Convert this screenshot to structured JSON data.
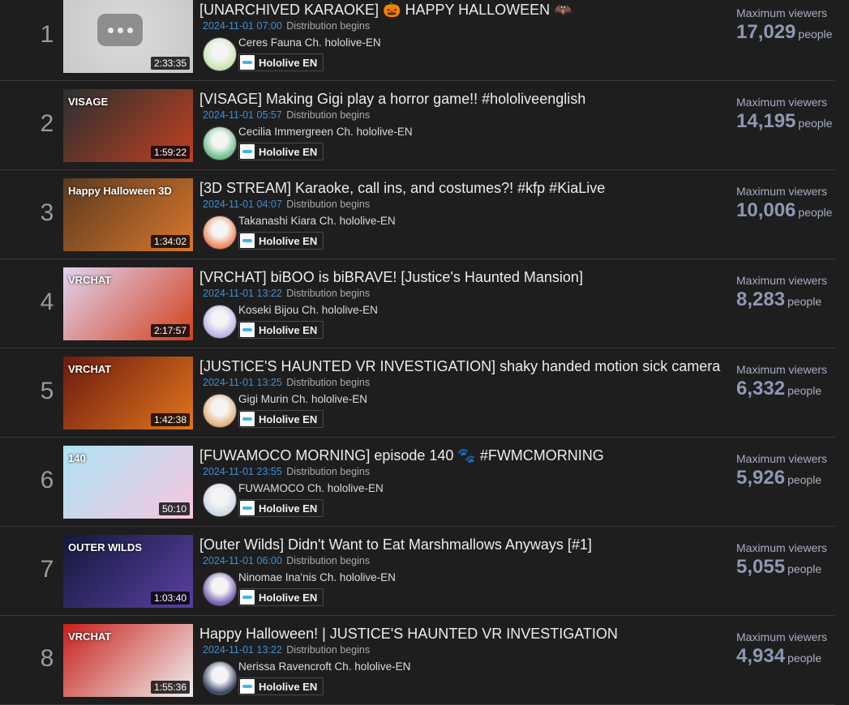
{
  "viewers_label": "Maximum viewers",
  "viewers_unit": "people",
  "distribution_label": "Distribution begins",
  "rows": [
    {
      "rank": "1",
      "title": "[UNARCHIVED KARAOKE] 🎃 HAPPY HALLOWEEN 🦇",
      "date": "2024-11-01 07:00",
      "channel": "Ceres Fauna Ch. hololive-EN",
      "org": "Hololive EN",
      "duration": "2:33:35",
      "viewers": "17,029",
      "thumb_colors": [
        "#dcdcdc",
        "#c8c8c8"
      ],
      "avatar_color": "#c9e6b0"
    },
    {
      "rank": "2",
      "title": "[VISAGE] Making Gigi play a horror game!! #hololiveenglish",
      "date": "2024-11-01 05:57",
      "channel": "Cecilia Immergreen Ch. hololive-EN",
      "org": "Hololive EN",
      "duration": "1:59:22",
      "viewers": "14,195",
      "thumb_colors": [
        "#2b2f33",
        "#c0401e"
      ],
      "thumb_text": "VISAGE",
      "avatar_color": "#6dbf8a"
    },
    {
      "rank": "3",
      "title": "[3D STREAM] Karaoke, call ins, and costumes?! #kfp #KiaLive",
      "date": "2024-11-01 04:07",
      "channel": "Takanashi Kiara Ch. hololive-EN",
      "org": "Hololive EN",
      "duration": "1:34:02",
      "viewers": "10,006",
      "thumb_colors": [
        "#5a3a20",
        "#d9772b"
      ],
      "thumb_text": "Happy Halloween 3D",
      "avatar_color": "#f08a5d"
    },
    {
      "rank": "4",
      "title": "[VRCHAT] biBOO is biBRAVE! [Justice's Haunted Mansion]",
      "date": "2024-11-01 13:22",
      "channel": "Koseki Bijou Ch. hololive-EN",
      "org": "Hololive EN",
      "duration": "2:17:57",
      "viewers": "8,283",
      "thumb_colors": [
        "#e0d4f2",
        "#d2401a"
      ],
      "thumb_text": "VRCHAT",
      "avatar_color": "#b9b4e6"
    },
    {
      "rank": "5",
      "title": "[JUSTICE'S HAUNTED VR INVESTIGATION] shaky handed motion sick camera",
      "date": "2024-11-01 13:25",
      "channel": "Gigi Murin Ch. hololive-EN",
      "org": "Hololive EN",
      "duration": "1:42:38",
      "viewers": "6,332",
      "thumb_colors": [
        "#6a1a10",
        "#e2761c"
      ],
      "thumb_text": "VRCHAT",
      "avatar_color": "#e8b27a"
    },
    {
      "rank": "6",
      "title": "[FUWAMOCO MORNING] episode 140 🐾 #FWMCMORNING",
      "date": "2024-11-01 23:55",
      "channel": "FUWAMOCO Ch. hololive-EN",
      "org": "Hololive EN",
      "duration": "50:10",
      "viewers": "5,926",
      "thumb_colors": [
        "#aee3f5",
        "#f6c6de"
      ],
      "thumb_text": "140",
      "avatar_color": "#cfd8e8"
    },
    {
      "rank": "7",
      "title": "[Outer Wilds] Didn't Want to Eat Marshmallows Anyways [#1]",
      "date": "2024-11-01 06:00",
      "channel": "Ninomae Ina'nis Ch. hololive-EN",
      "org": "Hololive EN",
      "duration": "1:03:40",
      "viewers": "5,055",
      "thumb_colors": [
        "#121a3a",
        "#5b3fa3"
      ],
      "thumb_text": "OUTER WILDS",
      "avatar_color": "#7a5fb8"
    },
    {
      "rank": "8",
      "title": "Happy Halloween! | JUSTICE'S HAUNTED VR INVESTIGATION",
      "date": "2024-11-01 13:22",
      "channel": "Nerissa Ravencroft Ch. hololive-EN",
      "org": "Hololive EN",
      "duration": "1:55:36",
      "viewers": "4,934",
      "thumb_colors": [
        "#c8201a",
        "#f0f0f0"
      ],
      "thumb_text": "VRCHAT",
      "avatar_color": "#3d4a6a"
    }
  ]
}
